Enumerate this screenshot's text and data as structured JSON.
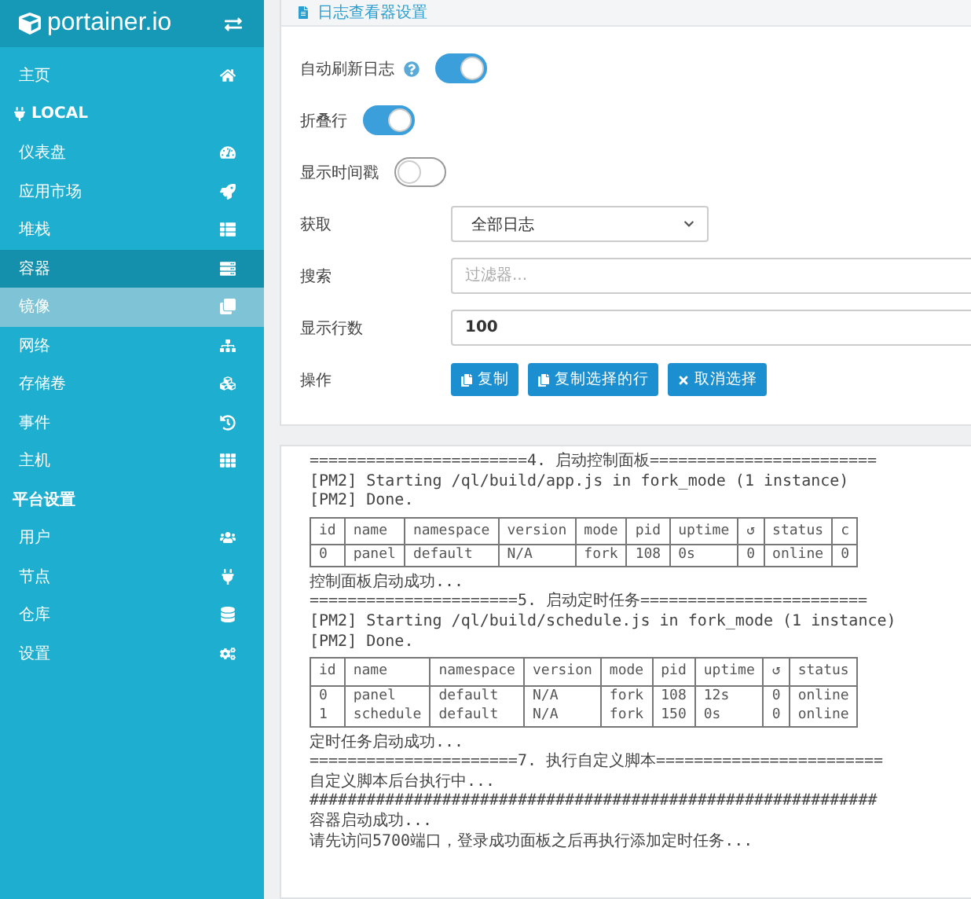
{
  "sidebar": {
    "logo": "portainer.io",
    "items": [
      {
        "kind": "item",
        "label": "主页",
        "selected": false,
        "hovered": false
      },
      {
        "kind": "section",
        "label": "LOCAL"
      },
      {
        "kind": "item",
        "label": "仪表盘",
        "selected": false,
        "hovered": false
      },
      {
        "kind": "item",
        "label": "应用市场",
        "selected": false,
        "hovered": false
      },
      {
        "kind": "item",
        "label": "堆栈",
        "selected": false,
        "hovered": false
      },
      {
        "kind": "item",
        "label": "容器",
        "selected": true,
        "hovered": false
      },
      {
        "kind": "item",
        "label": "镜像",
        "selected": false,
        "hovered": true
      },
      {
        "kind": "item",
        "label": "网络",
        "selected": false,
        "hovered": false
      },
      {
        "kind": "item",
        "label": "存储卷",
        "selected": false,
        "hovered": false
      },
      {
        "kind": "item",
        "label": "事件",
        "selected": false,
        "hovered": false
      },
      {
        "kind": "item",
        "label": "主机",
        "selected": false,
        "hovered": false
      },
      {
        "kind": "section",
        "label": "平台设置"
      },
      {
        "kind": "item",
        "label": "用户",
        "selected": false,
        "hovered": false
      },
      {
        "kind": "item",
        "label": "节点",
        "selected": false,
        "hovered": false
      },
      {
        "kind": "item",
        "label": "仓库",
        "selected": false,
        "hovered": false
      },
      {
        "kind": "item",
        "label": "设置",
        "selected": false,
        "hovered": false
      }
    ]
  },
  "settings": {
    "title": "日志查看器设置",
    "rows": [
      {
        "kind": "toggle",
        "label": "自动刷新日志",
        "help": true,
        "on": true
      },
      {
        "kind": "toggle",
        "label": "折叠行",
        "help": false,
        "on": true
      },
      {
        "kind": "toggle",
        "label": "显示时间戳",
        "help": false,
        "on": false
      },
      {
        "kind": "select",
        "label": "获取",
        "value": "全部日志"
      },
      {
        "kind": "input",
        "label": "搜索",
        "placeholder": "过滤器..."
      },
      {
        "kind": "input",
        "label": "显示行数",
        "value": "100"
      },
      {
        "kind": "buttons",
        "label": "操作",
        "buttons": [
          {
            "label": "复制"
          },
          {
            "label": "复制选择的行"
          },
          {
            "label": "取消选择"
          }
        ]
      }
    ]
  },
  "log": [
    {
      "kind": "line",
      "text": "=======================4. 启动控制面板========================"
    },
    {
      "kind": "line",
      "text": "[PM2] Starting /ql/build/app.js in fork_mode (1 instance)"
    },
    {
      "kind": "line",
      "text": "[PM2] Done."
    },
    {
      "kind": "table",
      "columns": [
        "id",
        "name",
        "namespace",
        "version",
        "mode",
        "pid",
        "uptime",
        "↺",
        "status",
        "c"
      ],
      "rows": [
        [
          "0",
          "panel",
          "default",
          "N/A",
          "fork",
          "108",
          "0s",
          "0",
          "online",
          "0"
        ]
      ]
    },
    {
      "kind": "line",
      "text": "控制面板启动成功..."
    },
    {
      "kind": "line",
      "text": "======================5. 启动定时任务========================"
    },
    {
      "kind": "line",
      "text": "[PM2] Starting /ql/build/schedule.js in fork_mode (1 instance)"
    },
    {
      "kind": "line",
      "text": "[PM2] Done."
    },
    {
      "kind": "table",
      "columns": [
        "id",
        "name",
        "namespace",
        "version",
        "mode",
        "pid",
        "uptime",
        "↺",
        "status"
      ],
      "rows": [
        [
          "0",
          "panel",
          "default",
          "N/A",
          "fork",
          "108",
          "12s",
          "0",
          "online"
        ],
        [
          "1",
          "schedule",
          "default",
          "N/A",
          "fork",
          "150",
          "0s",
          "0",
          "online"
        ]
      ]
    },
    {
      "kind": "line",
      "text": "定时任务启动成功..."
    },
    {
      "kind": "line",
      "text": "======================7. 执行自定义脚本========================"
    },
    {
      "kind": "line",
      "text": "自定义脚本后台执行中..."
    },
    {
      "kind": "line",
      "text": "############################################################"
    },
    {
      "kind": "line",
      "text": "容器启动成功..."
    },
    {
      "kind": "line",
      "text": "请先访问5700端口，登录成功面板之后再执行添加定时任务..."
    }
  ]
}
